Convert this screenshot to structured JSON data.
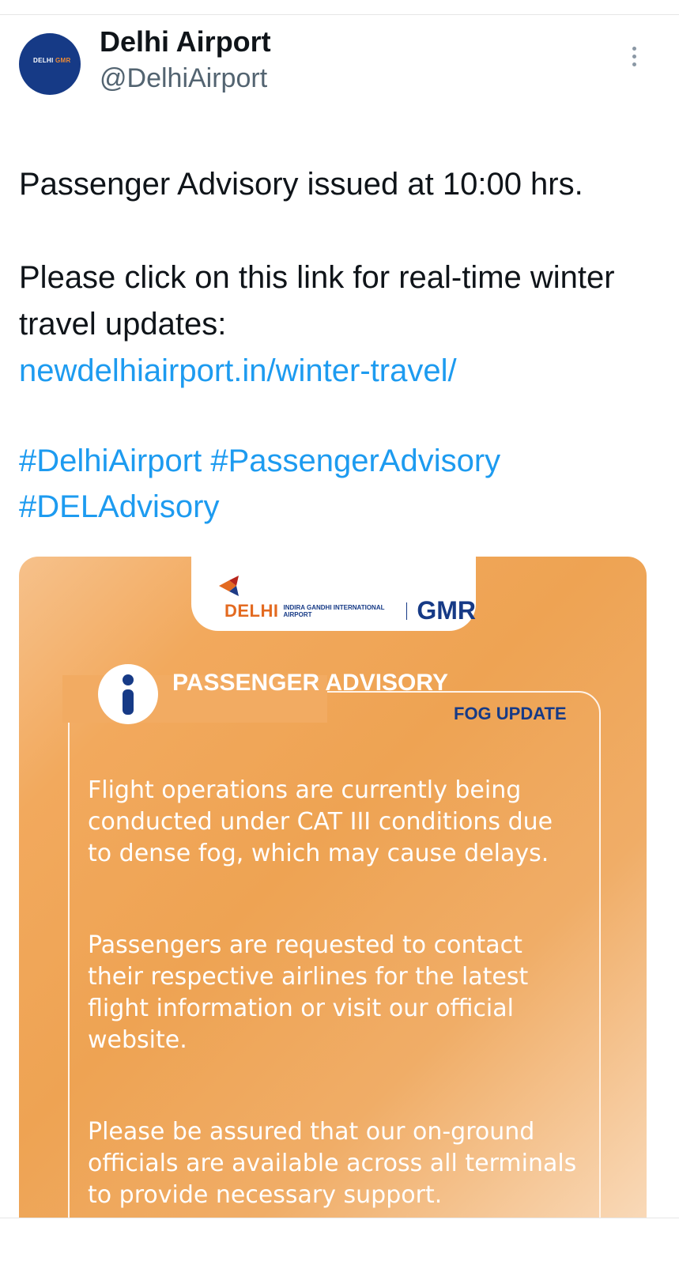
{
  "tweet": {
    "display_name": "Delhi Airport",
    "handle": "@DelhiAirport",
    "line1": "Passenger Advisory issued at 10:00 hrs.",
    "line2": "Please click on this link for real-time winter travel updates:",
    "link": "newdelhiairport.in/winter-travel/",
    "hashtags": "#DelhiAirport #PassengerAdvisory #DELAdvisory"
  },
  "media": {
    "brand_delhi": "DELHI",
    "brand_igia": "INDIRA GANDHI INTERNATIONAL AIRPORT",
    "brand_gmr": "GMR",
    "advisory_title": "PASSENGER ADVISORY",
    "badge": "FOG UPDATE",
    "paragraphs": [
      "Flight operations are currently being conducted under CAT III conditions due to dense fog, which may cause delays.",
      "Passengers are requested to contact their respective airlines for the latest flight information or visit our official website.",
      "Please be assured that our on-ground officials are available across all terminals to provide necessary support."
    ]
  },
  "avatar": {
    "delhi": "DELHI",
    "gmr": "GMR"
  },
  "icons": [
    "more-options-icon",
    "info-icon",
    "airport-logo-icon"
  ]
}
